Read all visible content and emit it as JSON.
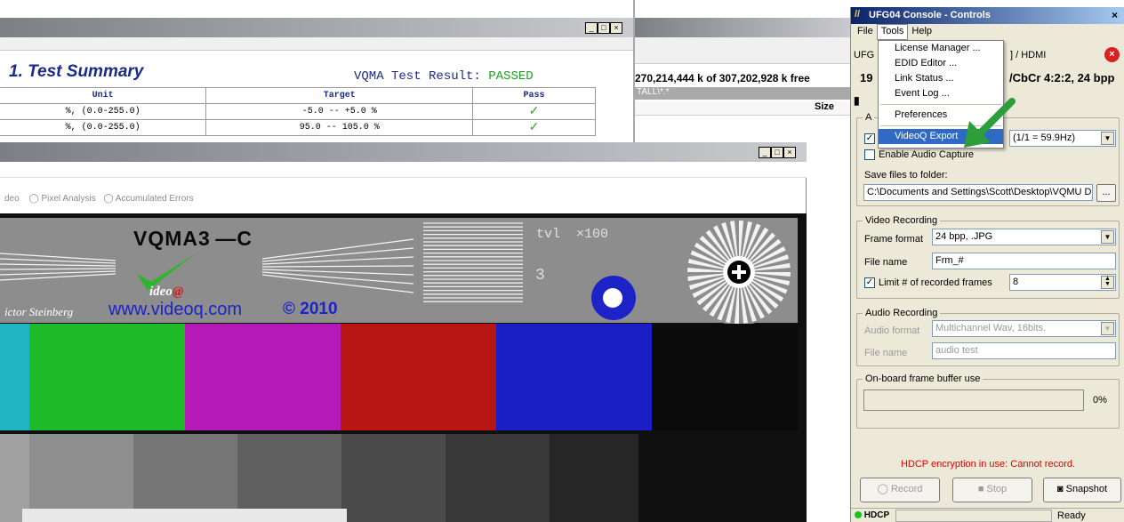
{
  "report": {
    "heading": "1. Test Summary",
    "result_label": "VQMA Test Result:",
    "result_value": "PASSED",
    "headers": [
      "Unit",
      "Target",
      "Pass"
    ],
    "rows": [
      {
        "unit": "%, (0.0-255.0)",
        "target": "-5.0 -- +5.0 %",
        "pass": "✓"
      },
      {
        "unit": "%, (0.0-255.0)",
        "target": "95.0 -- 105.0 %",
        "pass": "✓"
      }
    ]
  },
  "explorer": {
    "free_space": "270,214,444 k of 307,202,928 k free",
    "path": "TALL\\*.*",
    "size_header": "Size"
  },
  "analyzer": {
    "radio_video_partial": "deo",
    "radio_pixel": "Pixel Analysis",
    "radio_accum": "Accumulated Errors",
    "pattern_name": "VQMA3 —C",
    "tvl_label": "tvl  ×100",
    "tvl_value": "3",
    "logo_text": "ideo",
    "author": "ictor Steinberg",
    "website": "www.videoq.com",
    "copyright": "© 2010"
  },
  "console": {
    "title": "UFG04 Console - Controls",
    "menu": [
      "File",
      "Tools",
      "Help"
    ],
    "device_prefix": "UFG",
    "device_suffix": "] / HDMI",
    "res_prefix": "19",
    "res_suffix": "/CbCr 4:2:2, 24 bpp",
    "tab_partial": "A",
    "rate_value": "(1/1 = 59.9Hz)",
    "enable_audio_label": "Enable Audio Capture",
    "save_folder_label": "Save files to folder:",
    "save_folder_value": "C:\\Documents and Settings\\Scott\\Desktop\\VQMU D",
    "browse_label": "...",
    "video_section": "Video Recording",
    "frame_format_label": "Frame format",
    "frame_format_value": "24 bpp, .JPG",
    "file_name_label": "File name",
    "file_name_value": "Frm_#",
    "limit_label": "Limit # of recorded frames",
    "limit_value": "8",
    "audio_section": "Audio Recording",
    "audio_format_label": "Audio format",
    "audio_format_value": "Multichannel Wav, 16bits.",
    "audio_file_label": "File name",
    "audio_file_value": "audio test",
    "buffer_section": "On-board frame buffer use",
    "buffer_percent_text": "0%",
    "buffer_fraction": 0,
    "hdcp_warning": "HDCP encryption in use: Cannot record.",
    "record_label": "Record",
    "stop_label": "Stop",
    "snapshot_label": "Snapshot",
    "status_hdcp": "HDCP",
    "status_ready": "Ready",
    "accent": "#0a246a",
    "warning_color": "#e00000"
  },
  "tools_menu": {
    "items": [
      "License Manager ...",
      "EDID Editor ...",
      "Link Status ...",
      "Event Log ...",
      "Preferences",
      "VideoQ Export"
    ],
    "selected": "VideoQ Export"
  },
  "color_bars": [
    "#1fb5c1",
    "#1dbb27",
    "#b51ab8",
    "#b81515",
    "#1a1ec4",
    "#0b0b0b"
  ],
  "gray_bars": [
    "#a0a0a0",
    "#8e8e8e",
    "#767676",
    "#606060",
    "#4a4a4a",
    "#383838",
    "#262626"
  ]
}
